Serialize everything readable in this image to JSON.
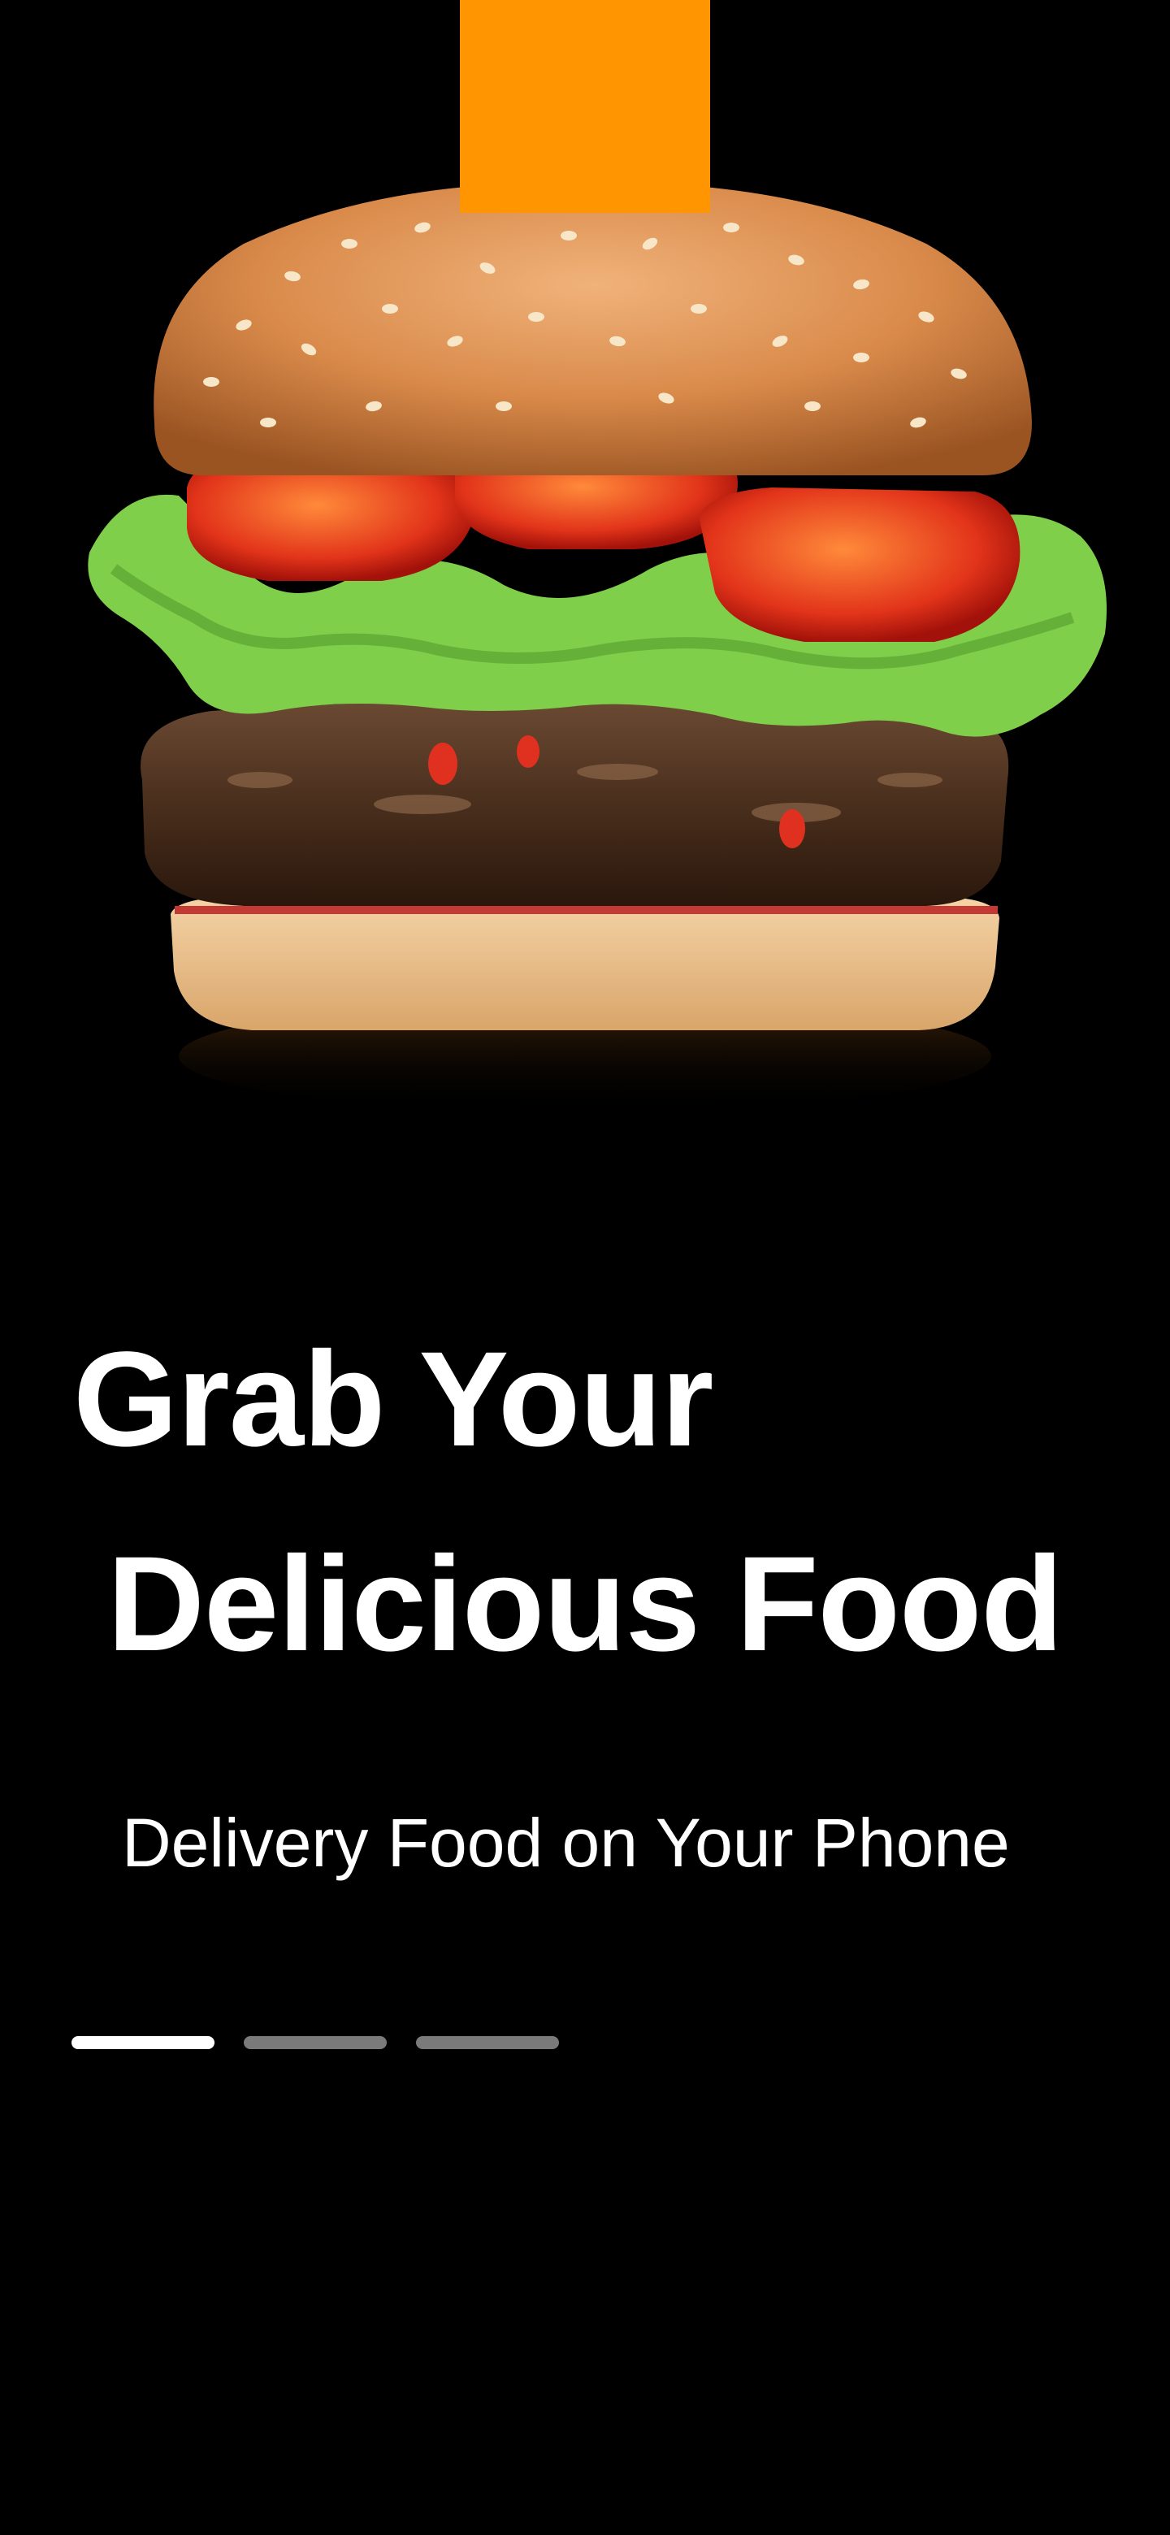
{
  "onboarding": {
    "title_line1": "Grab Your",
    "title_line2": "Delicious Food",
    "subtitle": "Delivery Food on Your Phone",
    "page_indicator": {
      "count": 3,
      "active_index": 0
    }
  },
  "colors": {
    "background": "#000000",
    "accent": "#FF9500",
    "text": "#FFFFFF",
    "indicator_active": "#FFFFFF",
    "indicator_inactive": "#7A7A7A"
  },
  "hero_image": {
    "subject": "burger-image"
  }
}
